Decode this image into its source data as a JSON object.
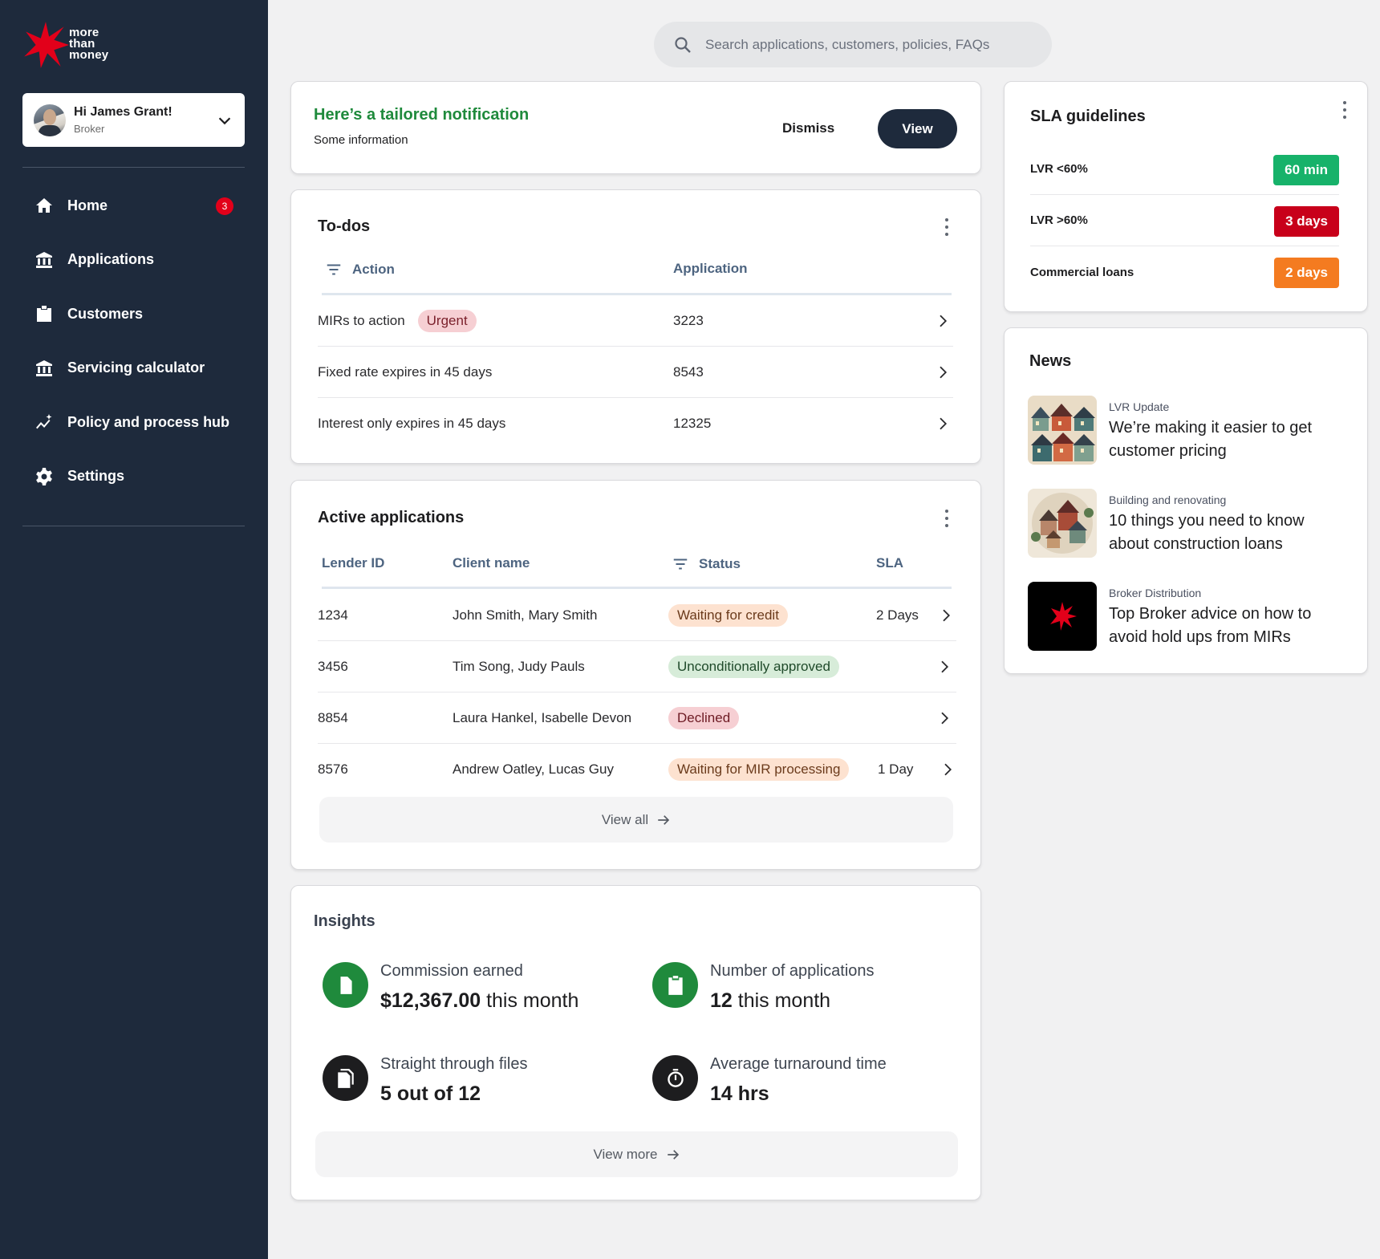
{
  "brand": {
    "logo_text": [
      "more",
      "than",
      "money"
    ],
    "accent": "#e2001a",
    "sidebar_bg": "#1e2a3c"
  },
  "user": {
    "greeting": "Hi James Grant!",
    "role": "Broker"
  },
  "nav": [
    {
      "label": "Home",
      "icon": "home-icon",
      "badge": "3"
    },
    {
      "label": "Applications",
      "icon": "bank-icon"
    },
    {
      "label": "Customers",
      "icon": "badge-icon"
    },
    {
      "label": "Servicing calculator",
      "icon": "bank-icon"
    },
    {
      "label": "Policy and process hub",
      "icon": "sparkle-chart-icon"
    },
    {
      "label": "Settings",
      "icon": "gear-icon"
    }
  ],
  "search": {
    "placeholder": "Search applications, customers, policies, FAQs"
  },
  "notification": {
    "title": "Here’s a tailored notification",
    "text": "Some information",
    "dismiss_label": "Dismiss",
    "view_label": "View"
  },
  "todos": {
    "title": "To-dos",
    "headers": {
      "action": "Action",
      "application": "Application"
    },
    "rows": [
      {
        "action": "MIRs to action",
        "tag": "Urgent",
        "application": "3223"
      },
      {
        "action": "Fixed rate expires in 45 days",
        "application": "8543"
      },
      {
        "action": "Interest only expires in 45 days",
        "application": "12325"
      }
    ]
  },
  "active_applications": {
    "title": "Active applications",
    "headers": {
      "lender_id": "Lender ID",
      "client_name": "Client name",
      "status": "Status",
      "sla": "SLA"
    },
    "rows": [
      {
        "lender_id": "1234",
        "client_name": "John Smith, Mary Smith",
        "status": "Waiting for credit",
        "status_type": "orange",
        "sla": "2 Days"
      },
      {
        "lender_id": "3456",
        "client_name": "Tim Song, Judy Pauls",
        "status": "Unconditionally approved",
        "status_type": "green",
        "sla": ""
      },
      {
        "lender_id": "8854",
        "client_name": "Laura Hankel, Isabelle Devon",
        "status": "Declined",
        "status_type": "red",
        "sla": ""
      },
      {
        "lender_id": "8576",
        "client_name": "Andrew Oatley, Lucas Guy",
        "status": "Waiting for MIR processing",
        "status_type": "orange",
        "sla": "1 Day"
      }
    ],
    "view_all_label": "View all"
  },
  "insights": {
    "title": "Insights",
    "items": [
      {
        "label": "Commission earned",
        "value_bold": "$12,367.00",
        "value_rest": " this month",
        "icon": "dollar-document-icon",
        "color": "#1f8a3c"
      },
      {
        "label": "Number of applications",
        "value_bold": "12",
        "value_rest": " this month",
        "icon": "clipboard-icon",
        "color": "#1f8a3c"
      },
      {
        "label": "Straight through files",
        "value_bold": "5 out of 12",
        "value_rest": "",
        "icon": "files-icon",
        "color": "#1d1d1f"
      },
      {
        "label": "Average turnaround time",
        "value_bold": "14 hrs",
        "value_rest": "",
        "icon": "stopwatch-icon",
        "color": "#1d1d1f"
      }
    ],
    "view_more_label": "View more"
  },
  "sla": {
    "title": "SLA guidelines",
    "rows": [
      {
        "label": "LVR <60%",
        "value": "60 min",
        "color": "#17b26a"
      },
      {
        "label": "LVR >60%",
        "value": "3 days",
        "color": "#c8001a"
      },
      {
        "label": "Commercial loans",
        "value": "2 days",
        "color": "#f47b20"
      }
    ]
  },
  "news": {
    "title": "News",
    "items": [
      {
        "category": "LVR Update",
        "headline": "We’re making it easier to get customer pricing",
        "thumb": "houses-illustration"
      },
      {
        "category": "Building and renovating",
        "headline": "10 things you need to know about construction loans",
        "thumb": "village-illustration"
      },
      {
        "category": "Broker Distribution",
        "headline": "Top Broker advice on how to avoid hold ups from MIRs",
        "thumb": "star-logo"
      }
    ]
  }
}
